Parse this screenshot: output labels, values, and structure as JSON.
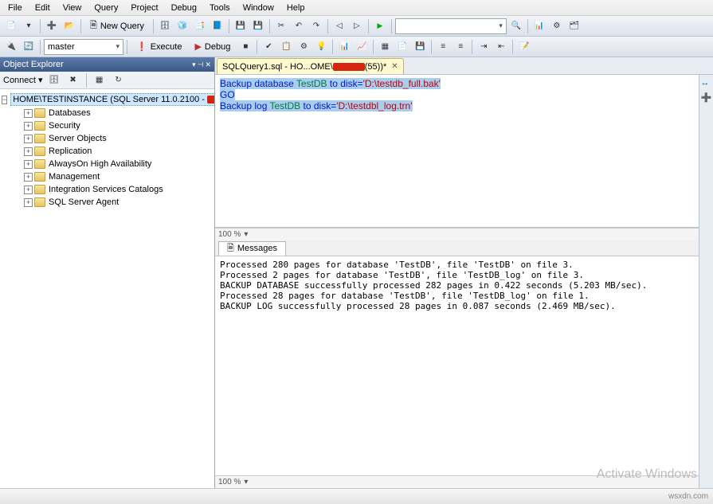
{
  "menu": [
    "File",
    "Edit",
    "View",
    "Query",
    "Project",
    "Debug",
    "Tools",
    "Window",
    "Help"
  ],
  "toolbar1": {
    "new_query": "New Query"
  },
  "toolbar2": {
    "db_combo": "master",
    "execute": "Execute",
    "debug": "Debug"
  },
  "object_explorer": {
    "title": "Object Explorer",
    "connect_label": "Connect ▾",
    "root": "HOME\\TESTINSTANCE (SQL Server 11.0.2100 - ",
    "nodes": [
      "Databases",
      "Security",
      "Server Objects",
      "Replication",
      "AlwaysOn High Availability",
      "Management",
      "Integration Services Catalogs",
      "SQL Server Agent"
    ]
  },
  "tab": {
    "label": "SQLQuery1.sql - HO...OME\\",
    "suffix": "(55))*"
  },
  "code": {
    "l1a": "Backup database ",
    "l1b": "TestDB",
    "l1c": " to disk=",
    "l1d": "'D:\\testdb_full.bak'",
    "l2": "GO",
    "l3a": "Backup ",
    "l3b": "log",
    "l3c": " TestDB",
    "l3d": " to disk=",
    "l3e": "'D:\\testdbl_log.trn'"
  },
  "zoom": "100 %",
  "messages_tab": "Messages",
  "messages": "Processed 280 pages for database 'TestDB', file 'TestDB' on file 3.\nProcessed 2 pages for database 'TestDB', file 'TestDB_log' on file 3.\nBACKUP DATABASE successfully processed 282 pages in 0.422 seconds (5.203 MB/sec).\nProcessed 28 pages for database 'TestDB', file 'TestDB_log' on file 1.\nBACKUP LOG successfully processed 28 pages in 0.087 seconds (2.469 MB/sec).",
  "watermark": "Activate Windows",
  "attribution": "wsxdn.com"
}
